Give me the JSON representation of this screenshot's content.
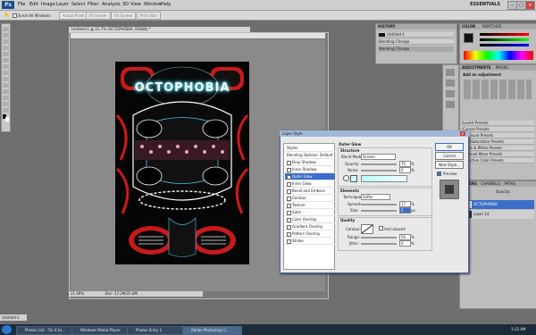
{
  "menubar": {
    "items": [
      "File",
      "Edit",
      "Image",
      "Layer",
      "Select",
      "Filter",
      "Analysis",
      "3D",
      "View",
      "Window",
      "Help"
    ],
    "workspace": "ESSENTIALS"
  },
  "options_bar": {
    "scroll_all": "Scroll All Windows",
    "buttons": [
      "Actual Pixels",
      "Fit Screen",
      "Fill Screen",
      "Print Size"
    ]
  },
  "document": {
    "tab": "Untitled-1 @ 21.7% (OCTOPHOBIA, RGB/8) *",
    "zoom": "21.69%",
    "doc_size": "Doc: 17.2M/25.8M",
    "poster_title": "OCTOPHOBIA",
    "bg_tab": "Untitled-1"
  },
  "history_panel": {
    "tab": "HISTORY",
    "items": [
      "Untitled-1",
      "Blending Change",
      "Blending Change"
    ]
  },
  "color_panel": {
    "tab": "COLOR",
    "tab2": "SWATCHES"
  },
  "adjustments_panel": {
    "tab": "ADJUSTMENTS",
    "tab2": "MASKS",
    "heading": "Add an adjustment",
    "presets": [
      "Levels Presets",
      "Curves Presets",
      "Exposure Presets",
      "Hue/Saturation Presets",
      "Black & White Presets",
      "Channel Mixer Presets",
      "Selective Color Presets"
    ]
  },
  "layers_panel": {
    "tab": "LAYERS",
    "tab2": "CHANNELS",
    "tab3": "PATHS",
    "opacity": "Opacity:",
    "layers": [
      "OCTOPHOBIA",
      "Layer 14"
    ]
  },
  "layer_style": {
    "title": "Layer Style",
    "styles": [
      {
        "label": "Styles",
        "check": false,
        "sel": false
      },
      {
        "label": "Blending Options: Default",
        "check": false,
        "sel": false
      },
      {
        "label": "Drop Shadow",
        "check": true,
        "sel": false
      },
      {
        "label": "Inner Shadow",
        "check": true,
        "sel": false
      },
      {
        "label": "Outer Glow",
        "check": true,
        "sel": true
      },
      {
        "label": "Inner Glow",
        "check": true,
        "sel": false
      },
      {
        "label": "Bevel and Emboss",
        "check": true,
        "sel": false
      },
      {
        "label": "Contour",
        "check": true,
        "sel": false
      },
      {
        "label": "Texture",
        "check": true,
        "sel": false
      },
      {
        "label": "Satin",
        "check": true,
        "sel": false
      },
      {
        "label": "Color Overlay",
        "check": true,
        "sel": false
      },
      {
        "label": "Gradient Overlay",
        "check": true,
        "sel": false
      },
      {
        "label": "Pattern Overlay",
        "check": true,
        "sel": false
      },
      {
        "label": "Stroke",
        "check": true,
        "sel": false
      }
    ],
    "section_title": "Outer Glow",
    "structure": "Structure",
    "blend_mode_label": "Blend Mode:",
    "blend_mode_value": "Screen",
    "opacity_label": "Opacity:",
    "opacity_value": "75",
    "noise_label": "Noise:",
    "noise_value": "0",
    "elements": "Elements",
    "technique_label": "Technique:",
    "technique_value": "Softer",
    "spread_label": "Spread:",
    "spread_value": "17",
    "size_label": "Size:",
    "size_value": "5",
    "quality": "Quality",
    "contour_label": "Contour:",
    "antialiased": "Anti-aliased",
    "range_label": "Range:",
    "range_value": "50",
    "jitter_label": "Jitter:",
    "jitter_value": "0",
    "pct": "%",
    "px": "px",
    "ok": "OK",
    "cancel": "Cancel",
    "new_style": "New Style...",
    "preview": "Preview"
  },
  "taskbar": {
    "tasks": [
      "Photos List - Tie it to...",
      "Windows Media Player",
      "Photos Entry 1",
      "Adobe Photoshop C..."
    ],
    "clock": "3:12 AM"
  },
  "colors": {
    "glow": "#cfffff",
    "accent_red": "#d01818",
    "selection": "#3a6ec8"
  }
}
